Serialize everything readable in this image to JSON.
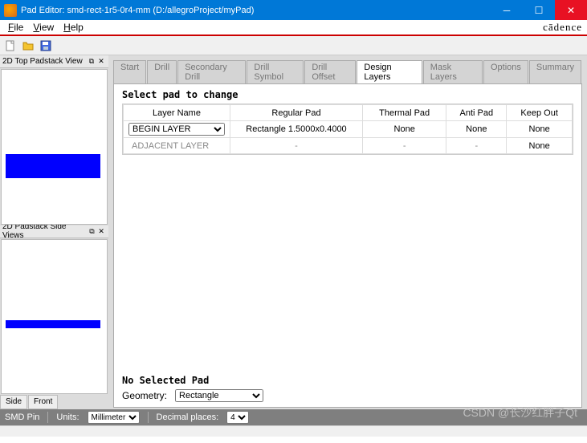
{
  "window": {
    "title": "Pad Editor: smd-rect-1r5-0r4-mm  (D:/allegroProject/myPad)"
  },
  "menu": {
    "items": [
      "File",
      "View",
      "Help"
    ],
    "brand": "cādence"
  },
  "side": {
    "top_title": "2D Top Padstack View",
    "side_title": "2D Padstack Side Views",
    "tabs": [
      "Side",
      "Front"
    ]
  },
  "tabs": [
    "Start",
    "Drill",
    "Secondary Drill",
    "Drill Symbol",
    "Drill Offset",
    "Design Layers",
    "Mask Layers",
    "Options",
    "Summary"
  ],
  "active_tab": "Design Layers",
  "design": {
    "section_title": "Select pad to change",
    "headers": [
      "Layer Name",
      "Regular Pad",
      "Thermal Pad",
      "Anti Pad",
      "Keep Out"
    ],
    "rows": [
      {
        "layer": "BEGIN LAYER",
        "regular": "Rectangle 1.5000x0.4000",
        "thermal": "None",
        "anti": "None",
        "keepout": "None"
      },
      {
        "layer": "ADJACENT LAYER",
        "regular": "-",
        "thermal": "-",
        "anti": "-",
        "keepout": "None"
      }
    ],
    "no_selected": "No Selected Pad",
    "geometry_label": "Geometry:",
    "geometry_value": "Rectangle"
  },
  "status": {
    "mode": "SMD Pin",
    "units_label": "Units:",
    "units": "Millimeter",
    "decimal_label": "Decimal places:",
    "decimal": "4"
  },
  "watermark": "CSDN @长沙红胖子Qt"
}
